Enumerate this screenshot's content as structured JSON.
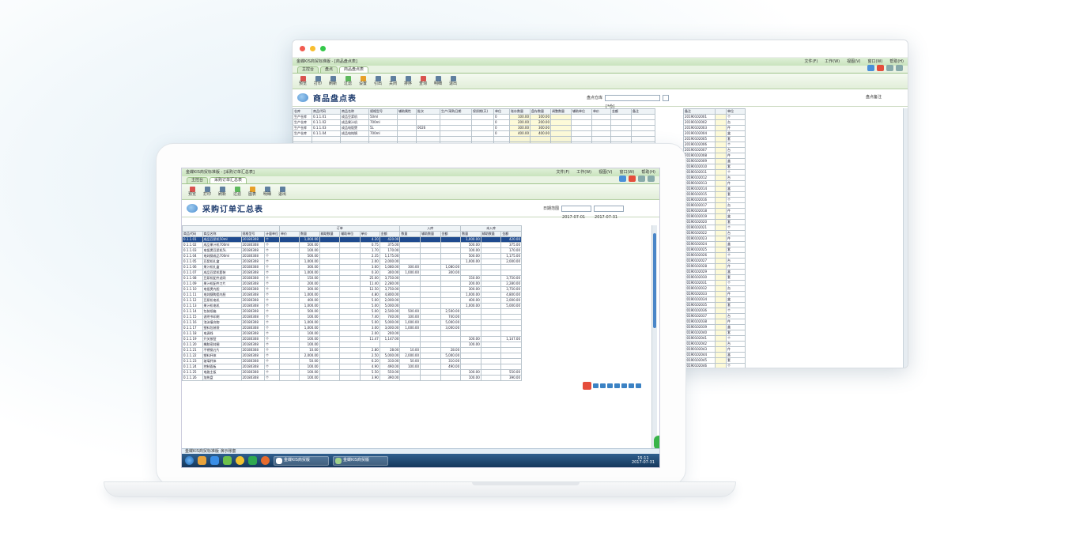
{
  "back_window": {
    "title": "金蝶KIS商贸标准版 - [商品盘点表]",
    "menus": [
      "文件(F)",
      "工作(W)",
      "视图(V)",
      "窗口(W)",
      "帮助(H)"
    ],
    "tabs": [
      "主控台",
      "盘点",
      "商品盘点表"
    ],
    "toolbar": [
      "预览",
      "打印",
      "刷新",
      "过滤",
      "设置",
      "引出",
      "关闭",
      "排序",
      "查询",
      "明细",
      "退出"
    ],
    "page_title": "商品盘点表",
    "filter_label": "盘点仓库",
    "filter_value": "[*仓]",
    "side_label": "盘点备注",
    "columns": [
      "仓库",
      "商品代码",
      "商品名称",
      "规格型号",
      "辅助属性",
      "批次",
      "生产/采购日期",
      "保质期(天)",
      "单位",
      "账存数量",
      "盘存数量",
      "调整数量",
      "辅助单位",
      "单价",
      "金额",
      "备注"
    ],
    "rows": [
      [
        "生产仓库",
        "0.1.1.01",
        "成品豆浆机",
        "50ml",
        "",
        "",
        "",
        "",
        "0",
        "100.00",
        "100.00",
        ""
      ],
      [
        "生产仓库",
        "0.1.1.02",
        "成品果汁机",
        "700ml",
        "",
        "",
        "",
        "",
        "0",
        "200.00",
        "200.00",
        ""
      ],
      [
        "生产仓库",
        "0.1.1.03",
        "成品电饭煲",
        "5L",
        "",
        "0026",
        "",
        "",
        "0",
        "300.00",
        "300.00",
        ""
      ],
      [
        "生产仓库",
        "0.1.1.04",
        "成品电炖锅",
        "700ml",
        "",
        "",
        "",
        "",
        "0",
        "400.00",
        "400.00",
        ""
      ]
    ],
    "right_codes": [
      "20190102001",
      "20190102002",
      "20190102003",
      "20190102004",
      "20190102005",
      "20190102006",
      "20190102007",
      "20190102008",
      "20190102009",
      "20190102010",
      "20190102011",
      "20190102012",
      "20190102013",
      "20190102014",
      "20190102015",
      "20190102016",
      "20190102017",
      "20190102018",
      "20190102019",
      "20190102020",
      "20190102021",
      "20190102022",
      "20190102023",
      "20190102024",
      "20190102025",
      "20190102026",
      "20190102027",
      "20190102028",
      "20190102029",
      "20190102030",
      "20190102031",
      "20190102032",
      "20190102033",
      "20190102034",
      "20190102035",
      "20190102036",
      "20190102037",
      "20190102038",
      "20190102039",
      "20190102040",
      "20190102041",
      "20190102042",
      "20190102043",
      "20190102044",
      "20190102045",
      "20190102046"
    ],
    "right_units": [
      "个",
      "台",
      "件",
      "盒",
      "套"
    ]
  },
  "front_window": {
    "title": "金蝶KIS商贸标准版 - [采购订单汇总表]",
    "menus": [
      "文件(F)",
      "工作(W)",
      "视图(V)",
      "窗口(W)",
      "帮助(H)"
    ],
    "tabs": [
      "主控台",
      "采购订单汇总表"
    ],
    "toolbar": [
      "预览",
      "打印",
      "刷新",
      "过滤",
      "图表",
      "明细",
      "退出"
    ],
    "page_title": "采购订单汇总表",
    "date_label": "日期范围",
    "date_from": "2017-07-01",
    "date_to": "2017-07-31",
    "group_headers": [
      "订单",
      "入库",
      "未入库"
    ],
    "columns": [
      "商品代码",
      "商品名称",
      "规格型号",
      "计量单位",
      "单价",
      "数量",
      "辅助数量",
      "辅助单位",
      "单价",
      "金额",
      "数量",
      "辅助数量",
      "金额",
      "数量",
      "辅助数量",
      "金额"
    ],
    "rows": [
      [
        "0.1.1.01",
        "成品豆浆机50ml",
        "20180308",
        "个",
        "1,000.00",
        "4.20",
        "420.00",
        "",
        "",
        "",
        "1,000.00",
        "420.00"
      ],
      [
        "0.1.1.02",
        "成品果汁机700ml",
        "20180308",
        "个",
        "500.00",
        "0.75",
        "375.00",
        "",
        "",
        "",
        "500.00",
        "375.00"
      ],
      [
        "0.1.1.03",
        "电饭煲豆浆机5L",
        "20180308",
        "个",
        "100.00",
        "1.70",
        "170.00",
        "",
        "",
        "",
        "100.00",
        "170.00"
      ],
      [
        "0.1.1.04",
        "电炖锅成品700ml",
        "20180308",
        "个",
        "500.00",
        "2.35",
        "1,175.00",
        "",
        "",
        "",
        "500.00",
        "1,175.00"
      ],
      [
        "0.1.1.05",
        "豆浆机礼盒",
        "20180308",
        "个",
        "1,000.00",
        "2.00",
        "2,000.00",
        "",
        "",
        "",
        "1,000.00",
        "2,000.00"
      ],
      [
        "0.1.1.06",
        "果汁机礼盒",
        "20180308",
        "个",
        "300.00",
        "3.60",
        "1,080.00",
        "300.00",
        "1,080.00",
        "",
        "",
        ""
      ],
      [
        "0.1.1.07",
        "成品豆浆机套装",
        "20180308",
        "个",
        "1,000.00",
        "0.30",
        "300.00",
        "1,000.00",
        "300.00",
        "",
        "",
        ""
      ],
      [
        "0.1.1.08",
        "豆浆机配件滤网",
        "20180308",
        "个",
        "150.00",
        "25.00",
        "3,750.00",
        "",
        "",
        "",
        "150.00",
        "3,750.00"
      ],
      [
        "0.1.1.09",
        "果汁机配件刀片",
        "20180308",
        "个",
        "200.00",
        "11.40",
        "2,280.00",
        "",
        "",
        "",
        "200.00",
        "2,280.00"
      ],
      [
        "0.1.1.10",
        "电饭煲内胆",
        "20180308",
        "个",
        "300.00",
        "12.50",
        "3,750.00",
        "",
        "",
        "",
        "300.00",
        "3,750.00"
      ],
      [
        "0.1.1.11",
        "电炖锅陶瓷内胆",
        "20180308",
        "个",
        "1,000.00",
        "4.80",
        "4,800.00",
        "",
        "",
        "",
        "1,000.00",
        "4,800.00"
      ],
      [
        "0.1.1.12",
        "豆浆机电机",
        "20180308",
        "个",
        "400.00",
        "5.00",
        "2,000.00",
        "",
        "",
        "",
        "400.00",
        "2,000.00"
      ],
      [
        "0.1.1.13",
        "果汁机电机",
        "20180308",
        "个",
        "1,000.00",
        "5.00",
        "5,000.00",
        "",
        "",
        "",
        "1,000.00",
        "5,000.00"
      ],
      [
        "0.1.1.14",
        "包装纸箱",
        "20180308",
        "个",
        "500.00",
        "5.00",
        "2,500.00",
        "500.00",
        "2,500.00",
        "",
        "",
        ""
      ],
      [
        "0.1.1.15",
        "说明书印刷",
        "20180308",
        "个",
        "100.00",
        "7.40",
        "740.00",
        "100.00",
        "740.00",
        "",
        "",
        ""
      ],
      [
        "0.1.1.16",
        "泡沫填充物",
        "20180308",
        "个",
        "1,000.00",
        "5.00",
        "5,000.00",
        "1,000.00",
        "5,000.00",
        "",
        "",
        ""
      ],
      [
        "0.1.1.17",
        "塑料包装袋",
        "20180308",
        "个",
        "1,000.00",
        "3.00",
        "3,000.00",
        "1,000.00",
        "3,000.00",
        "",
        "",
        ""
      ],
      [
        "0.1.1.18",
        "电源线",
        "20180308",
        "个",
        "100.00",
        "2.00",
        "200.00",
        "",
        "",
        "",
        "",
        ""
      ],
      [
        "0.1.1.19",
        "开关按钮",
        "20180308",
        "个",
        "100.00",
        "11.47",
        "1,147.00",
        "",
        "",
        "",
        "100.00",
        "1,147.00"
      ],
      [
        "0.1.1.20",
        "橡胶密封圈",
        "20180308",
        "个",
        "100.00",
        "",
        "",
        "",
        "",
        "",
        "100.00",
        ""
      ],
      [
        "0.1.1.21",
        "不锈钢刀片",
        "20180308",
        "个",
        "10.00",
        "2.80",
        "28.00",
        "10.00",
        "28.00",
        "",
        "",
        ""
      ],
      [
        "0.1.1.22",
        "塑料杯体",
        "20180308",
        "个",
        "2,000.00",
        "2.50",
        "5,000.00",
        "2,000.00",
        "5,000.00",
        "",
        "",
        ""
      ],
      [
        "0.1.1.23",
        "玻璃杯体",
        "20180308",
        "个",
        "50.00",
        "6.20",
        "310.00",
        "50.00",
        "310.00",
        "",
        "",
        ""
      ],
      [
        "0.1.1.24",
        "控制面板",
        "20180308",
        "个",
        "100.00",
        "4.90",
        "490.00",
        "100.00",
        "490.00",
        "",
        "",
        ""
      ],
      [
        "0.1.1.25",
        "电路主板",
        "20180308",
        "个",
        "100.00",
        "5.50",
        "550.00",
        "",
        "",
        "",
        "100.00",
        "550.00"
      ],
      [
        "0.1.1.26",
        "加热盘",
        "20180308",
        "个",
        "100.00",
        "3.90",
        "390.00",
        "",
        "",
        "",
        "100.00",
        "390.00"
      ]
    ],
    "status_text": "金蝶KIS商贸标准版 演示账套",
    "taskbar_apps": [
      "金蝶KIS商贸版",
      "金蝶KIS商贸版"
    ],
    "clock_time": "15:11",
    "clock_date": "2017-07-31"
  }
}
